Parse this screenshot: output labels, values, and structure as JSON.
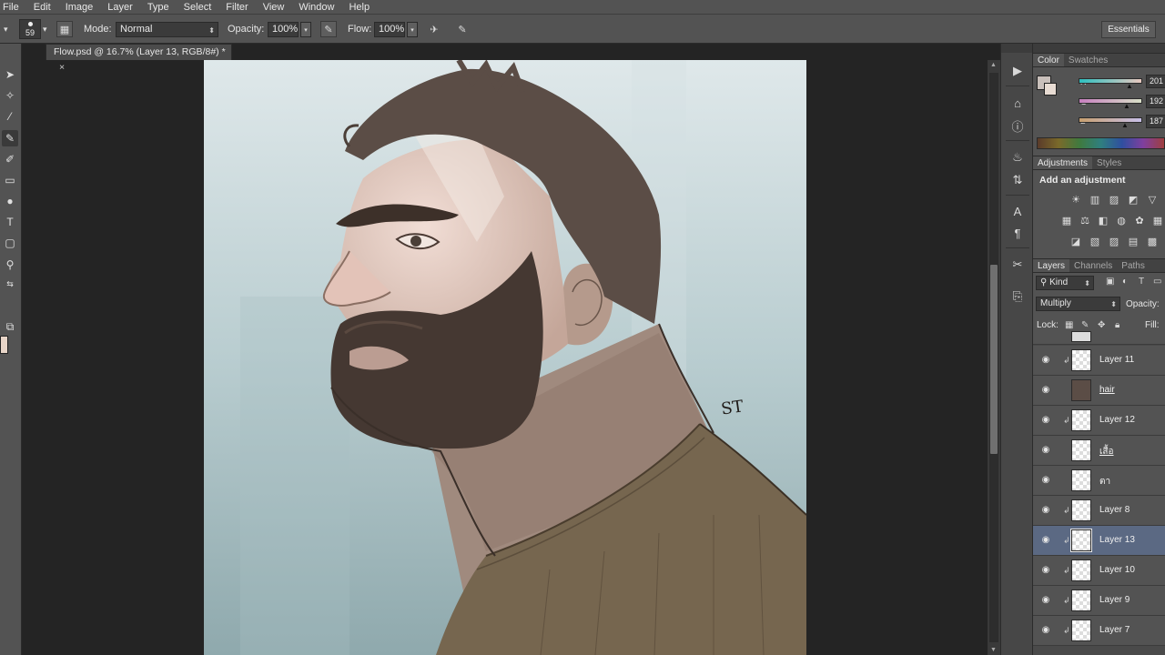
{
  "menu": [
    "File",
    "Edit",
    "Image",
    "Layer",
    "Type",
    "Select",
    "Filter",
    "View",
    "Window",
    "Help"
  ],
  "options_bar": {
    "brush_size": "59",
    "mode_label": "Mode:",
    "mode_value": "Normal",
    "opacity_label": "Opacity:",
    "opacity_value": "100%",
    "flow_label": "Flow:",
    "flow_value": "100%",
    "workspace": "Essentials"
  },
  "document": {
    "tab_title": "Flow.psd @ 16.7% (Layer 13, RGB/8#) *",
    "tab_close": "×",
    "signature": "ST"
  },
  "color_panel": {
    "tabs": [
      "Color",
      "Swatches"
    ],
    "r_label": "R",
    "r_value": "201",
    "g_label": "G",
    "g_value": "192",
    "b_label": "B",
    "b_value": "187",
    "foreground": "#c9c0bb"
  },
  "adjustments_panel": {
    "tabs": [
      "Adjustments",
      "Styles"
    ],
    "title": "Add an adjustment"
  },
  "layers_panel": {
    "tabs": [
      "Layers",
      "Channels",
      "Paths"
    ],
    "filter_kind": "Kind",
    "blend_mode": "Multiply",
    "opacity_label": "Opacity:",
    "lock_label": "Lock:",
    "fill_label": "Fill:",
    "layers": [
      {
        "name": "Layer 11",
        "clipped": true,
        "active": false,
        "underline": false
      },
      {
        "name": "hair",
        "clipped": false,
        "active": false,
        "underline": true
      },
      {
        "name": "Layer 12",
        "clipped": true,
        "active": false,
        "underline": false
      },
      {
        "name": "เสื้อ",
        "clipped": false,
        "active": false,
        "underline": true
      },
      {
        "name": "ตา",
        "clipped": false,
        "active": false,
        "underline": false
      },
      {
        "name": "Layer 8",
        "clipped": true,
        "active": false,
        "underline": false
      },
      {
        "name": "Layer 13",
        "clipped": true,
        "active": true,
        "underline": false
      },
      {
        "name": "Layer 10",
        "clipped": true,
        "active": false,
        "underline": false
      },
      {
        "name": "Layer 9",
        "clipped": true,
        "active": false,
        "underline": false
      },
      {
        "name": "Layer 7",
        "clipped": true,
        "active": false,
        "underline": false
      }
    ]
  }
}
